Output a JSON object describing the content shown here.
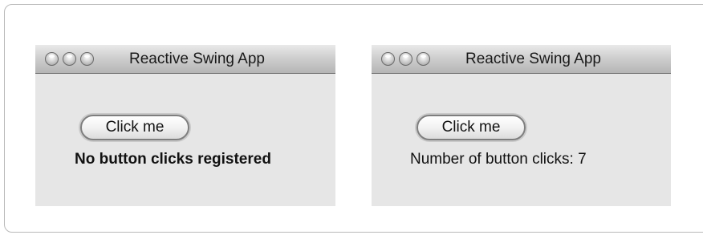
{
  "windows": [
    {
      "title": "Reactive Swing App",
      "button_label": "Click me",
      "status_text": "No button clicks registered"
    },
    {
      "title": "Reactive Swing App",
      "button_label": "Click me",
      "status_text": "Number of button clicks: 7"
    }
  ],
  "icons": {
    "window_controls": [
      "close-icon",
      "minimize-icon",
      "zoom-icon"
    ]
  },
  "colors": {
    "window_background": "#e6e6e6",
    "titlebar_top": "#e9e9e9",
    "titlebar_bottom": "#b5b5b5",
    "text": "#111111"
  }
}
